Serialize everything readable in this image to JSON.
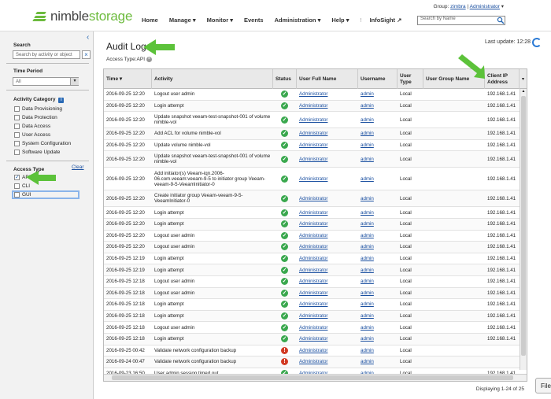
{
  "header": {
    "logo_prefix": "nimble",
    "logo_suffix": "storage",
    "group_label": "Group:",
    "group_name": "zimbra",
    "user_sep": "|",
    "user_name": "Administrator",
    "nav": [
      "Home",
      "Manage ▾",
      "Monitor ▾",
      "Events",
      "Administration ▾",
      "Help ▾"
    ],
    "nav_sep": "!",
    "infosight": "InfoSight ↗",
    "search_placeholder": "Search by Name"
  },
  "sidebar": {
    "search_label": "Search",
    "search_placeholder": "Search by activity or object",
    "time_period_label": "Time Period",
    "time_period_value": "All",
    "activity_category_label": "Activity Category",
    "activity_categories": [
      "Data Provisioning",
      "Data Protection",
      "Data Access",
      "User Access",
      "System Configuration",
      "Software Update"
    ],
    "access_type_label": "Access Type",
    "clear_label": "Clear",
    "access_types": [
      {
        "label": "API",
        "checked": true
      },
      {
        "label": "CLI",
        "checked": false
      },
      {
        "label": "GUI",
        "checked": false
      }
    ]
  },
  "main": {
    "title": "Audit Log",
    "last_update_label": "Last update: 12:28",
    "filter_chip": "Access Type:API",
    "footer": "Displaying 1-24 of 25",
    "file_button": "File"
  },
  "table": {
    "headers": [
      "Time ▾",
      "Activity",
      "Status",
      "User Full Name",
      "Username",
      "User Type",
      "User Group Name",
      "Client IP Address"
    ],
    "rows": [
      {
        "time": "2016-09-25 12:20",
        "activity": "Logout user admin",
        "status": "ok",
        "full": "Administrator",
        "user": "admin",
        "type": "Local",
        "group": "",
        "ip": "192.168.1.41"
      },
      {
        "time": "2016-09-25 12:20",
        "activity": "Login attempt",
        "status": "ok",
        "full": "Administrator",
        "user": "admin",
        "type": "Local",
        "group": "",
        "ip": "192.168.1.41"
      },
      {
        "time": "2016-09-25 12:20",
        "activity": "Update snapshot veeam-test-snapshot-001 of volume nimble-vol",
        "status": "ok",
        "full": "Administrator",
        "user": "admin",
        "type": "Local",
        "group": "",
        "ip": "192.168.1.41"
      },
      {
        "time": "2016-09-25 12:20",
        "activity": "Add ACL for volume nimble-vol",
        "status": "ok",
        "full": "Administrator",
        "user": "admin",
        "type": "Local",
        "group": "",
        "ip": "192.168.1.41"
      },
      {
        "time": "2016-09-25 12:20",
        "activity": "Update volume nimble-vol",
        "status": "ok",
        "full": "Administrator",
        "user": "admin",
        "type": "Local",
        "group": "",
        "ip": "192.168.1.41"
      },
      {
        "time": "2016-09-25 12:20",
        "activity": "Update snapshot veeam-test-snapshot-001 of volume nimble-vol",
        "status": "ok",
        "full": "Administrator",
        "user": "admin",
        "type": "Local",
        "group": "",
        "ip": "192.168.1.41"
      },
      {
        "time": "2016-09-25 12:20",
        "activity": "Add initiator(s) Veeam-iqn.2006-06.com.veeam:veeam-9-5 to initiator group Veeam-veeam-9-5-VeeamInitiator-0",
        "status": "ok",
        "full": "Administrator",
        "user": "admin",
        "type": "Local",
        "group": "",
        "ip": "192.168.1.41"
      },
      {
        "time": "2016-09-25 12:20",
        "activity": "Create initiator group Veeam-veeam-9-5-VeeamInitiator-0",
        "status": "ok",
        "full": "Administrator",
        "user": "admin",
        "type": "Local",
        "group": "",
        "ip": "192.168.1.41"
      },
      {
        "time": "2016-09-25 12:20",
        "activity": "Login attempt",
        "status": "ok",
        "full": "Administrator",
        "user": "admin",
        "type": "Local",
        "group": "",
        "ip": "192.168.1.41"
      },
      {
        "time": "2016-09-25 12:20",
        "activity": "Login attempt",
        "status": "ok",
        "full": "Administrator",
        "user": "admin",
        "type": "Local",
        "group": "",
        "ip": "192.168.1.41"
      },
      {
        "time": "2016-09-25 12:20",
        "activity": "Logout user admin",
        "status": "ok",
        "full": "Administrator",
        "user": "admin",
        "type": "Local",
        "group": "",
        "ip": "192.168.1.41"
      },
      {
        "time": "2016-09-25 12:20",
        "activity": "Logout user admin",
        "status": "ok",
        "full": "Administrator",
        "user": "admin",
        "type": "Local",
        "group": "",
        "ip": "192.168.1.41"
      },
      {
        "time": "2016-09-25 12:19",
        "activity": "Login attempt",
        "status": "ok",
        "full": "Administrator",
        "user": "admin",
        "type": "Local",
        "group": "",
        "ip": "192.168.1.41"
      },
      {
        "time": "2016-09-25 12:19",
        "activity": "Login attempt",
        "status": "ok",
        "full": "Administrator",
        "user": "admin",
        "type": "Local",
        "group": "",
        "ip": "192.168.1.41"
      },
      {
        "time": "2016-09-25 12:18",
        "activity": "Logout user admin",
        "status": "ok",
        "full": "Administrator",
        "user": "admin",
        "type": "Local",
        "group": "",
        "ip": "192.168.1.41"
      },
      {
        "time": "2016-09-25 12:18",
        "activity": "Logout user admin",
        "status": "ok",
        "full": "Administrator",
        "user": "admin",
        "type": "Local",
        "group": "",
        "ip": "192.168.1.41"
      },
      {
        "time": "2016-09-25 12:18",
        "activity": "Login attempt",
        "status": "ok",
        "full": "Administrator",
        "user": "admin",
        "type": "Local",
        "group": "",
        "ip": "192.168.1.41"
      },
      {
        "time": "2016-09-25 12:18",
        "activity": "Login attempt",
        "status": "ok",
        "full": "Administrator",
        "user": "admin",
        "type": "Local",
        "group": "",
        "ip": "192.168.1.41"
      },
      {
        "time": "2016-09-25 12:18",
        "activity": "Logout user admin",
        "status": "ok",
        "full": "Administrator",
        "user": "admin",
        "type": "Local",
        "group": "",
        "ip": "192.168.1.41"
      },
      {
        "time": "2016-09-25 12:18",
        "activity": "Login attempt",
        "status": "ok",
        "full": "Administrator",
        "user": "admin",
        "type": "Local",
        "group": "",
        "ip": "192.168.1.41"
      },
      {
        "time": "2016-09-25 00:42",
        "activity": "Validate network configuration backup",
        "status": "err",
        "full": "Administrator",
        "user": "admin",
        "type": "Local",
        "group": "",
        "ip": ""
      },
      {
        "time": "2016-09-24 00:47",
        "activity": "Validate network configuration backup",
        "status": "err",
        "full": "Administrator",
        "user": "admin",
        "type": "Local",
        "group": "",
        "ip": ""
      },
      {
        "time": "2016-09-23 16:50",
        "activity": "User admin session timed out",
        "status": "ok",
        "full": "Administrator",
        "user": "admin",
        "type": "Local",
        "group": "",
        "ip": "192.168.1.41"
      }
    ]
  },
  "colors": {
    "brand_green": "#6dbb3e",
    "link_blue": "#1a4fa0",
    "ok_green": "#3aa84e",
    "error_red": "#d23b25",
    "arrow_green": "#5cc23a"
  }
}
